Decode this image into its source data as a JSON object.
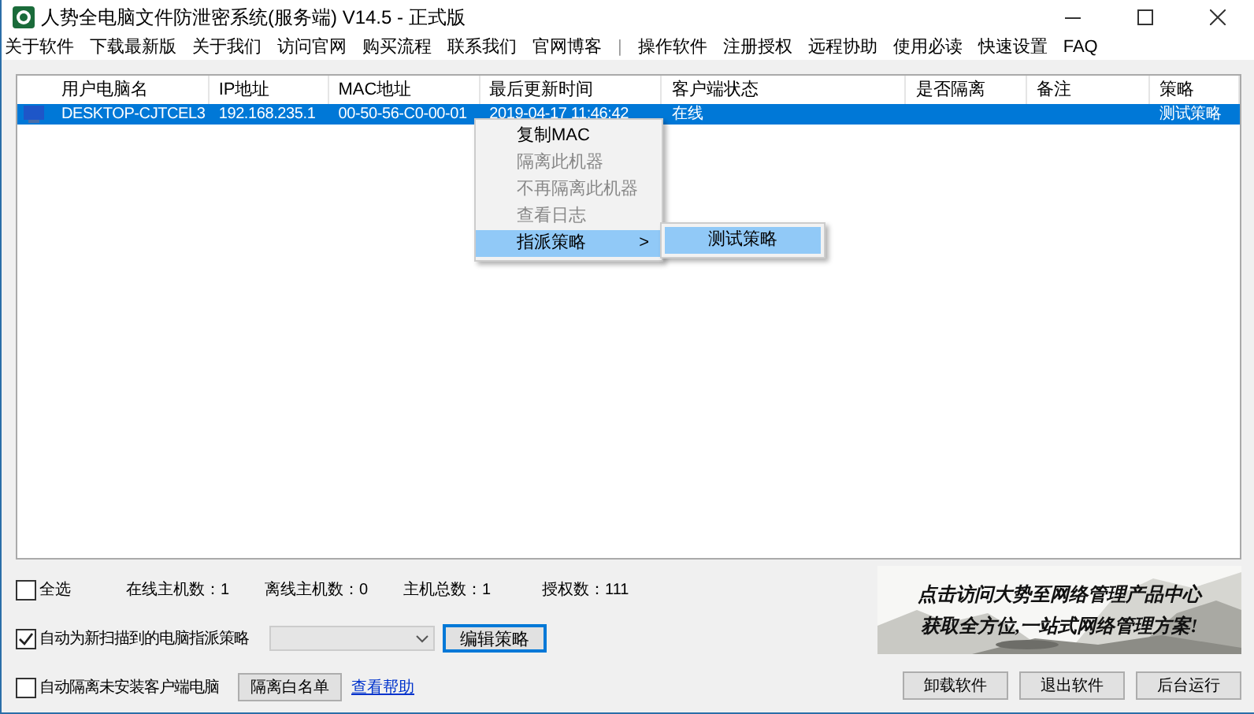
{
  "window": {
    "title": "人势全电脑文件防泄密系统(服务端) V14.5 - 正式版"
  },
  "menu": [
    "关于软件",
    "下载最新版",
    "关于我们",
    "访问官网",
    "购买流程",
    "联系我们",
    "官网博客",
    "|",
    "操作软件",
    "注册授权",
    "远程协助",
    "使用必读",
    "快速设置",
    "FAQ"
  ],
  "table": {
    "columns": [
      "用户电脑名",
      "IP地址",
      "MAC地址",
      "最后更新时间",
      "客户端状态",
      "是否隔离",
      "备注",
      "策略"
    ],
    "rows": [
      {
        "selected": true,
        "cells": [
          "DESKTOP-CJTCEL3",
          "192.168.235.1",
          "00-50-56-C0-00-01",
          "2019-04-17 11:46:42",
          "在线",
          "",
          "",
          "测试策略"
        ]
      }
    ]
  },
  "context_menu": {
    "items": [
      {
        "label": "复制MAC",
        "disabled": false,
        "selected": false
      },
      {
        "label": "隔离此机器",
        "disabled": true,
        "selected": false
      },
      {
        "label": "不再隔离此机器",
        "disabled": true,
        "selected": false
      },
      {
        "label": "查看日志",
        "disabled": true,
        "selected": false
      },
      {
        "label": "指派策略",
        "disabled": false,
        "selected": true,
        "submenu": true
      }
    ],
    "arrow": ">",
    "submenu": [
      {
        "label": "测试策略",
        "selected": true
      }
    ]
  },
  "select_all": {
    "label": "全选",
    "checked": false
  },
  "stats": [
    "在线主机数：1",
    "离线主机数：0",
    "主机总数：1",
    "授权数：111"
  ],
  "auto_assign": {
    "label": "自动为新扫描到的电脑指派策略",
    "checked": true
  },
  "edit_policy_button": "编辑策略",
  "auto_isolate": {
    "label": "自动隔离未安装客户端电脑",
    "checked": false
  },
  "whitelist_button": "隔离白名单",
  "help_link": "查看帮助",
  "banner": {
    "lines": [
      "点击访问大势至网络管理产品中心",
      "获取全方位,一站式网络管理方案!"
    ]
  },
  "buttons": [
    "卸载软件",
    "退出软件",
    "后台运行"
  ]
}
